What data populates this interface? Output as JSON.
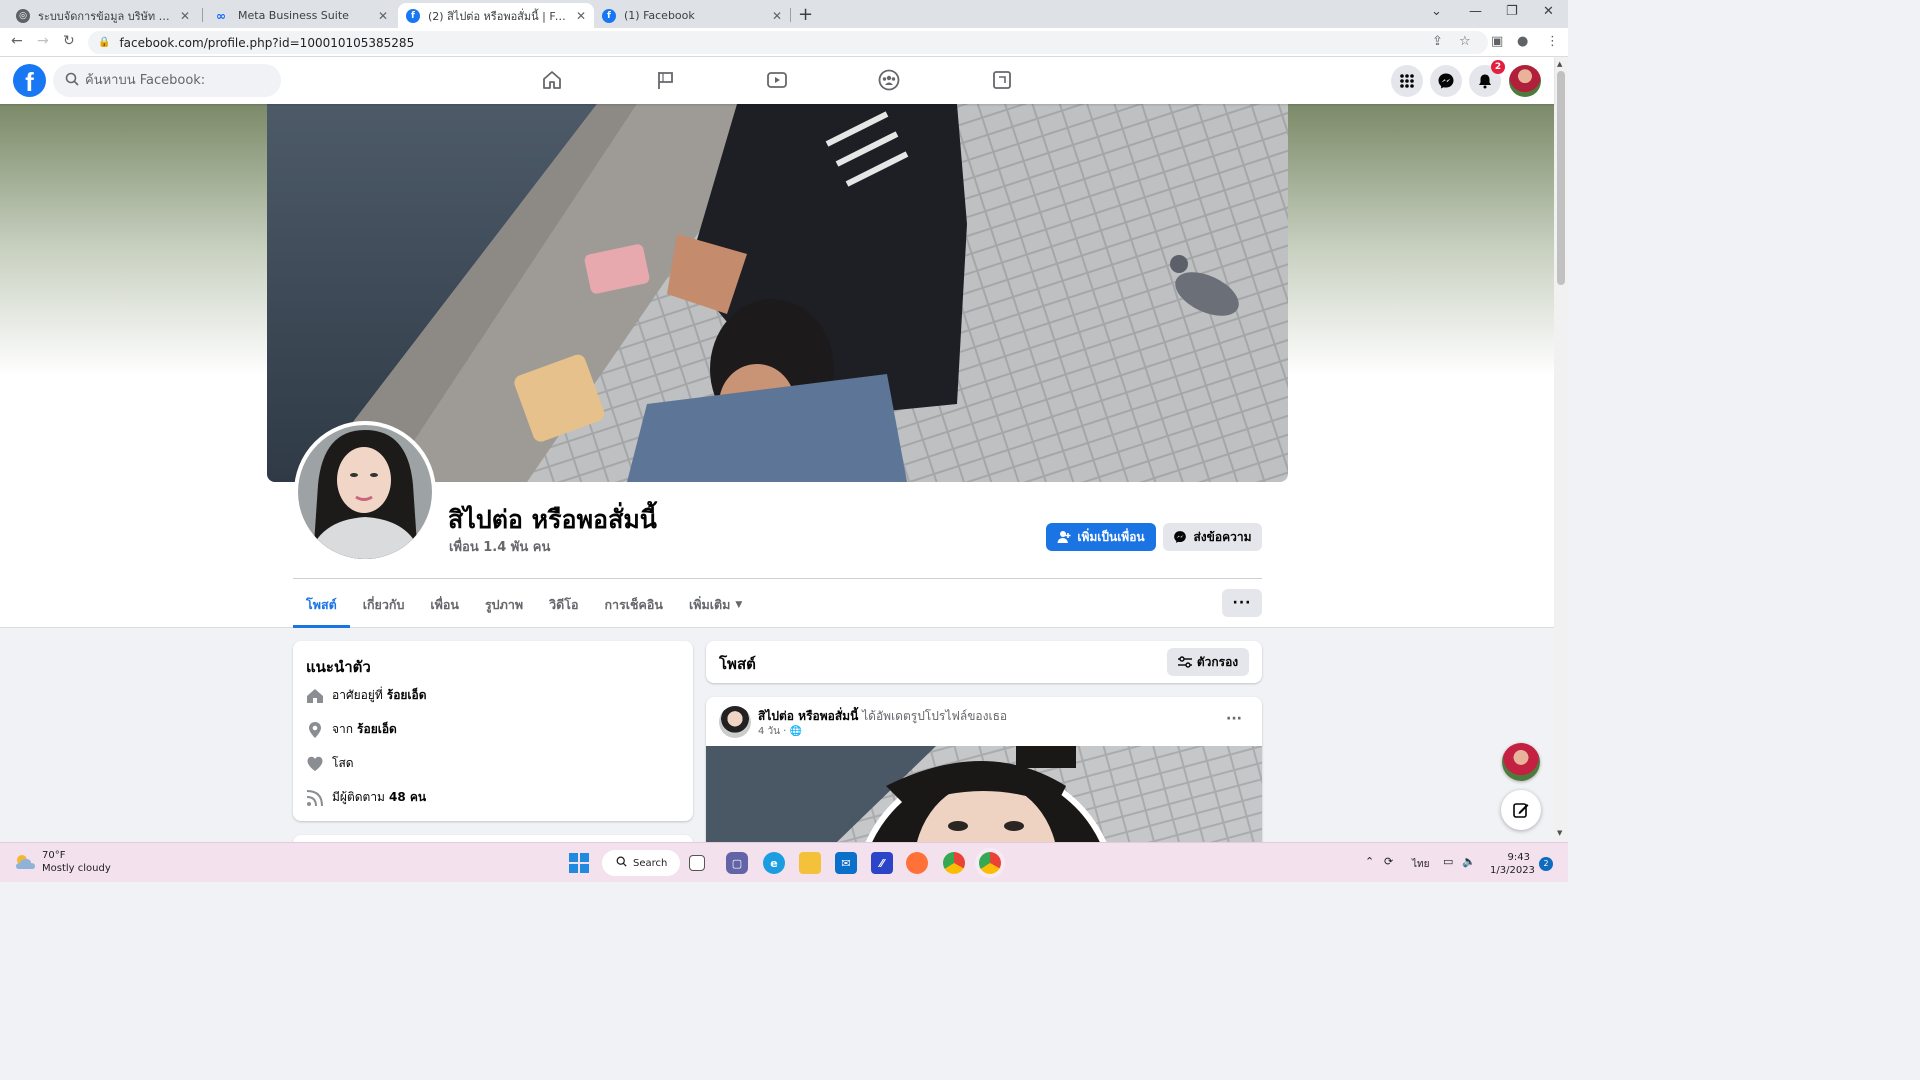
{
  "browser": {
    "tabs": [
      {
        "title": "ระบบจัดการข้อมูล บริษัท โชคลูกน้อย ...",
        "icon": "globe-icon"
      },
      {
        "title": "Meta Business Suite",
        "icon": "meta-icon"
      },
      {
        "title": "(2) สิไปต่อ หรือพอสั่มนี้ | Facebook",
        "icon": "facebook-icon"
      },
      {
        "title": "(1) Facebook",
        "icon": "facebook-icon"
      }
    ],
    "url": "facebook.com/profile.php?id=100010105385285"
  },
  "fb": {
    "search_placeholder": "ค้นหาบน Facebook:",
    "notification_count": "2",
    "logo_letter": "f"
  },
  "profile": {
    "name": "สิไปต่อ หรือพอสั่มนี้",
    "friends": "เพื่อน 1.4 พัน คน",
    "add_friend": "เพิ่มเป็นเพื่อน",
    "message": "ส่งข้อความ",
    "tabs": [
      "โพสต์",
      "เกี่ยวกับ",
      "เพื่อน",
      "รูปภาพ",
      "วิดีโอ",
      "การเช็คอิน",
      "เพิ่มเติม"
    ],
    "more_dots": "···"
  },
  "intro": {
    "title": "แนะนำตัว",
    "lives_prefix": "อาศัยอยู่ที่",
    "lives_value": "ร้อยเอ็ด",
    "from_prefix": "จาก",
    "from_value": "ร้อยเอ็ด",
    "relationship": "โสด",
    "followers_prefix": "มีผู้ติดตาม",
    "followers_value": "48 คน"
  },
  "posts": {
    "title": "โพสต์",
    "filter": "ตัวกรอง",
    "post": {
      "author": "สิไปต่อ หรือพอสั่มนี้",
      "action": "ได้อัพเดตรูปโปรไฟล์ของเธอ",
      "time": "4 วัน ·",
      "dots": "···"
    }
  },
  "taskbar": {
    "temp": "70°F",
    "weather": "Mostly cloudy",
    "search": "Search",
    "lang": "ไทย",
    "time": "9:43",
    "date": "1/3/2023",
    "notif_count": "2"
  },
  "colors": {
    "facebook_blue": "#1877f2",
    "primary_button": "#1b74e4",
    "badge_red": "#e41e3f"
  }
}
